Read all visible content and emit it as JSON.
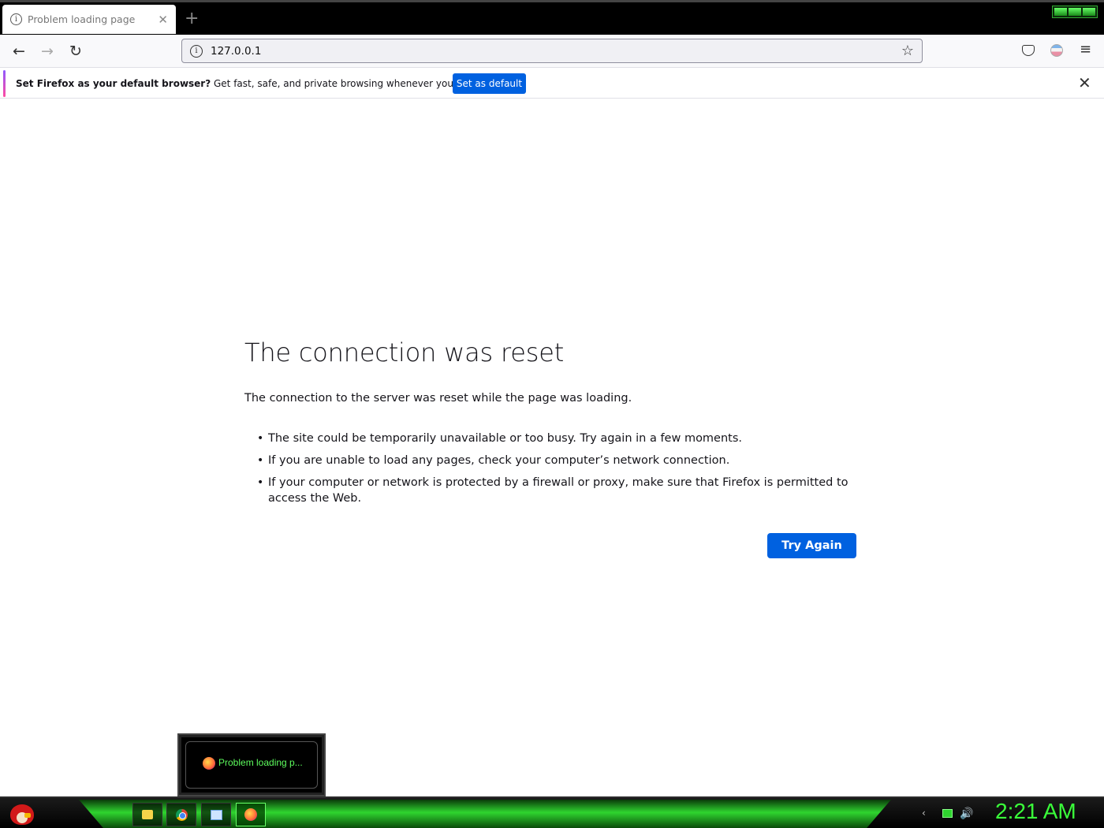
{
  "tab": {
    "title": "Problem loading page"
  },
  "newtab": {
    "label": "+"
  },
  "nav": {
    "url": "127.0.0.1"
  },
  "notice": {
    "bold": "Set Firefox as your default browser?",
    "text": " Get fast, safe, and private browsing whenever you use the web.",
    "button": "Set as default"
  },
  "error": {
    "title": "The connection was reset",
    "description": "The connection to the server was reset while the page was loading.",
    "bullets": [
      "The site could be temporarily unavailable or too busy. Try again in a few moments.",
      "If you are unable to load any pages, check your computer’s network connection.",
      "If your computer or network is protected by a firewall or proxy, make sure that Firefox is permitted to access the Web."
    ],
    "button": "Try Again"
  },
  "taskbar": {
    "thumbnail_label": "Problem loading p...",
    "clock": "2:21 AM",
    "items": [
      "folder-icon",
      "chrome-icon",
      "explorer-icon",
      "firefox-icon"
    ]
  },
  "colors": {
    "accent_blue": "#0061e0",
    "taskbar_green": "#2fd52f",
    "clock_green": "#3aff3a"
  }
}
